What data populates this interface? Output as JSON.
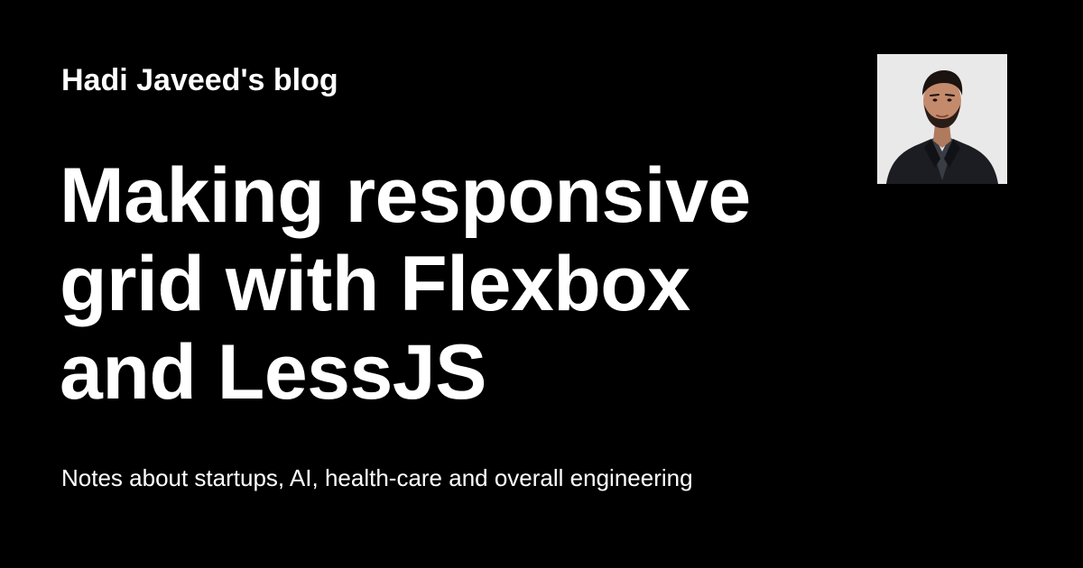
{
  "blog": {
    "name": "Hadi Javeed's blog"
  },
  "post": {
    "title": "Making responsive grid with Flexbox and LessJS"
  },
  "tagline": "Notes about startups, AI, health-care and overall engineering",
  "avatar": {
    "icon": "author-photo"
  },
  "colors": {
    "background": "#000000",
    "text": "#ffffff",
    "avatar_background": "#e9e9e9"
  }
}
